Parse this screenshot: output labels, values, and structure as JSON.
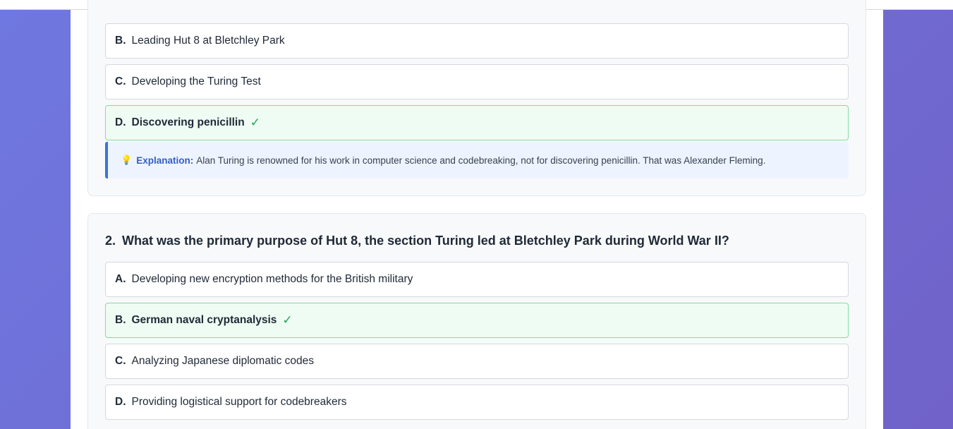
{
  "questions": [
    {
      "options": [
        {
          "letter": "B.",
          "text": "Leading Hut 8 at Bletchley Park",
          "correct": false
        },
        {
          "letter": "C.",
          "text": "Developing the Turing Test",
          "correct": false
        },
        {
          "letter": "D.",
          "text": "Discovering penicillin",
          "correct": true
        }
      ],
      "explanation": {
        "label": "Explanation:",
        "text": "Alan Turing is renowned for his work in computer science and codebreaking, not for discovering penicillin. That was Alexander Fleming."
      }
    },
    {
      "number": "2.",
      "title": "What was the primary purpose of Hut 8, the section Turing led at Bletchley Park during World War II?",
      "options": [
        {
          "letter": "A.",
          "text": "Developing new encryption methods for the British military",
          "correct": false
        },
        {
          "letter": "B.",
          "text": "German naval cryptanalysis",
          "correct": true
        },
        {
          "letter": "C.",
          "text": "Analyzing Japanese diplomatic codes",
          "correct": false
        },
        {
          "letter": "D.",
          "text": "Providing logistical support for codebreakers",
          "correct": false
        }
      ]
    }
  ],
  "check_mark": "✓",
  "bulb_icon": "💡",
  "colors": {
    "correct_border": "#86dba2",
    "correct_bg": "#effcf3",
    "check": "#22a355",
    "explanation_accent": "#3b73d9",
    "background_gradient_start": "#6f78e0",
    "background_gradient_end": "#7062c8"
  }
}
